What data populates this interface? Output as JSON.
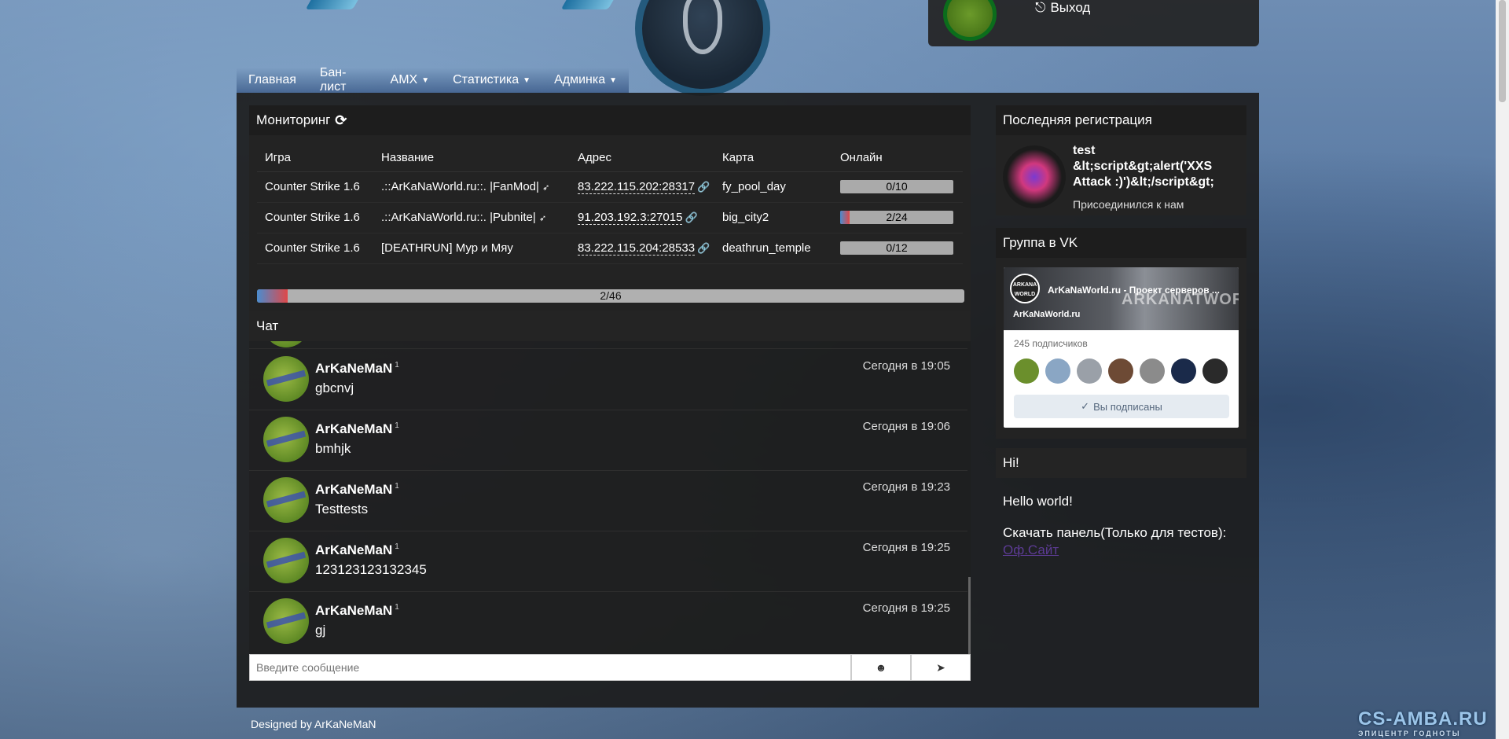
{
  "nav": {
    "items": [
      {
        "label": "Главная",
        "dropdown": false
      },
      {
        "label": "Бан-лист",
        "dropdown": false
      },
      {
        "label": "AMX",
        "dropdown": true
      },
      {
        "label": "Статистика",
        "dropdown": true
      },
      {
        "label": "Админка",
        "dropdown": true
      }
    ]
  },
  "user": {
    "logout_label": "Выход"
  },
  "monitoring": {
    "title": "Мониторинг",
    "columns": [
      "Игра",
      "Название",
      "Адрес",
      "Карта",
      "Онлайн"
    ],
    "servers": [
      {
        "game": "Counter Strike 1.6",
        "name": ".::ArKaNaWorld.ru::. |FanMod|",
        "address": "83.222.115.202:28317",
        "map": "fy_pool_day",
        "online": "0/10",
        "fill": 0
      },
      {
        "game": "Counter Strike 1.6",
        "name": ".::ArKaNaWorld.ru::. |Pubnite|",
        "address": "91.203.192.3:27015",
        "map": "big_city2",
        "online": "2/24",
        "fill": 0.083
      },
      {
        "game": "Counter Strike 1.6",
        "name": "[DEATHRUN] Мур и Мяу",
        "address": "83.222.115.204:28533",
        "map": "deathrun_temple",
        "online": "0/12",
        "fill": 0
      }
    ],
    "total": "2/46",
    "total_fill": 0.043
  },
  "chat": {
    "title": "Чат",
    "messages": [
      {
        "nick": "ArKaNeMaN",
        "badge": "1",
        "text": "gbcnvj",
        "time": "Сегодня в 19:05"
      },
      {
        "nick": "ArKaNeMaN",
        "badge": "1",
        "text": "bmhjk",
        "time": "Сегодня в 19:06"
      },
      {
        "nick": "ArKaNeMaN",
        "badge": "1",
        "text": "Testtests",
        "time": "Сегодня в 19:23"
      },
      {
        "nick": "ArKaNeMaN",
        "badge": "1",
        "text": "123123123132345",
        "time": "Сегодня в 19:25"
      },
      {
        "nick": "ArKaNeMaN",
        "badge": "1",
        "text": "gj",
        "time": "Сегодня в 19:25"
      }
    ],
    "input_placeholder": "Введите сообщение"
  },
  "last_registration": {
    "title": "Последняя регистрация",
    "username": "test &lt;script&gt;alert('XXS Attack :)')&lt;/script&gt;",
    "joined": "Присоединился к нам"
  },
  "vk": {
    "title": "Группа в VK",
    "group_title": "ArKaNaWorld.ru - Проект серверов ...",
    "group_name": "ArKaNaWorld.ru",
    "logo_text": "ARKANA WORLD",
    "watermark": "ARKANATWORLD",
    "subscribers": "245 подписчиков",
    "button": "Вы подписаны",
    "face_colors": [
      "#6b8f2c",
      "#8aa6c4",
      "#9aa0a8",
      "#6d4a35",
      "#8b8b8b",
      "#1a2a4a",
      "#2a2a2a"
    ]
  },
  "hi": {
    "title": "Hi!",
    "hello": "Hello world!",
    "download": "Скачать панель(Только для тестов):",
    "link": "Оф.Сайт"
  },
  "footer": {
    "text": "Designed by ArKaNeMaN"
  },
  "watermark": {
    "main": "CS-AMBA.RU",
    "sub": "ЭПИЦЕНТР ГОДНОТЫ"
  }
}
